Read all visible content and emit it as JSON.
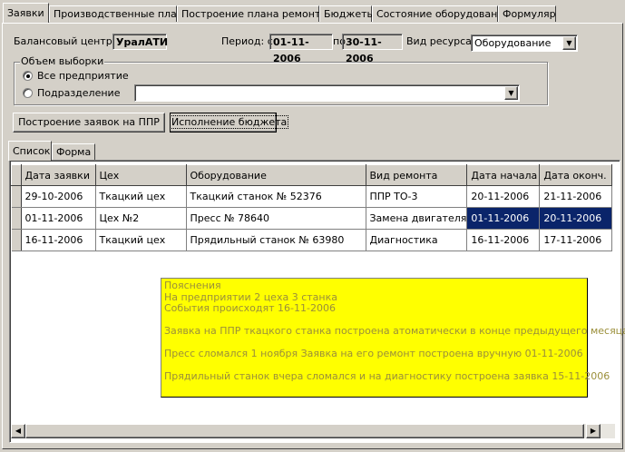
{
  "top_tabs": [
    "Заявки",
    "Производственные планы",
    "Построение плана ремонтов",
    "Бюджеты",
    "Состояние оборудования",
    "Формуляр"
  ],
  "header": {
    "balance_label": "Балансовый центр",
    "balance_value": "УралАТИ",
    "period_label": "Период: с",
    "period_from": "01-11-2006",
    "period_to_label": "по",
    "period_to": "30-11-2006",
    "resource_label": "Вид ресурса",
    "resource_value": "Оборудование"
  },
  "sample_group": {
    "title": "Объем выборки",
    "option_all": "Все предприятие",
    "option_division": "Подразделение",
    "division_value": ""
  },
  "buttons": {
    "build_requests": "Построение заявок на ППР",
    "budget_exec": "Исполнение бюджета"
  },
  "inner_tabs": [
    "Список",
    "Форма"
  ],
  "table": {
    "columns": [
      "Дата заявки",
      "Цех",
      "Оборудование",
      "Вид ремонта",
      "Дата начала",
      "Дата оконч."
    ],
    "rows": [
      [
        "29-10-2006",
        "Ткацкий цех",
        "Ткацкий станок № 52376",
        "ППР ТО-3",
        "20-11-2006",
        "21-11-2006"
      ],
      [
        "01-11-2006",
        "Цех №2",
        "Пресс № 78640",
        "Замена двигателя",
        "01-11-2006",
        "20-11-2006"
      ],
      [
        "16-11-2006",
        "Ткацкий цех",
        "Прядильный станок № 63980",
        "Диагностика",
        "16-11-2006",
        "17-11-2006"
      ]
    ]
  },
  "note": {
    "lines": [
      "Пояснения",
      "На предприятии 2 цеха 3 станка",
      "События происходят 16-11-2006",
      "",
      "Заявка на ППР ткацкого станка построена атоматически в конце предыдущего месяца",
      "",
      "Пресс сломался 1 ноября Заявка на его ремонт построена вручную 01-11-2006",
      "",
      "Прядильный станок вчера сломался и на диагностику построена заявка 15-11-2006"
    ]
  },
  "colors": {
    "face": "#d4d0c8",
    "selection": "#0a246a",
    "note_bg": "#ffff00",
    "note_text": "#9b8f3a"
  }
}
